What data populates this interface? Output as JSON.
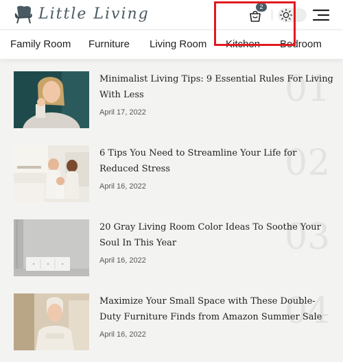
{
  "header": {
    "logo_text": "Little Living",
    "cart_count": "2"
  },
  "nav": {
    "items": [
      "Family Room",
      "Furniture",
      "Living Room",
      "Kitchen",
      "Bedroom"
    ]
  },
  "articles": [
    {
      "title": "Minimalist Living Tips: 9 Essential Rules For Living With Less",
      "date": "April 17, 2022",
      "number": "01"
    },
    {
      "title": "6 Tips You Need to Streamline Your Life for Reduced Stress",
      "date": "April 16, 2022",
      "number": "02"
    },
    {
      "title": "20 Gray Living Room Color Ideas To Soothe Your Soul In This Year",
      "date": "April 16, 2022",
      "number": "03"
    },
    {
      "title": "Maximize Your Small Space with These Double-Duty Furniture Finds from Amazon Summer Sale",
      "date": "April 16, 2022",
      "number": "04"
    }
  ],
  "icons": {
    "logo": "armchair-icon",
    "cart": "shopping-bag-icon",
    "theme": "sun-icon",
    "menu": "hamburger-menu-icon"
  },
  "colors": {
    "accent": "#4a5a63",
    "highlight_box": "#e0191f",
    "background": "#f3f4f2"
  }
}
